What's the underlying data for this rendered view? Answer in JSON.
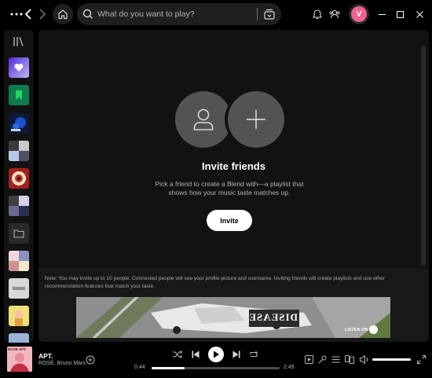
{
  "search": {
    "placeholder": "What do you want to play?"
  },
  "profile": {
    "initial": "V",
    "color": "#f06292"
  },
  "blend": {
    "title": "Invite friends",
    "description": "Pick a friend to create a Blend with—a playlist that shows how your music taste matches up.",
    "invite_button": "Invite",
    "note": "Note: You may invite up to 10 people. Connected people will see your profile picture and username. Inviting friends will create playlists and use other recommendation features that match your taste."
  },
  "ad": {
    "text": "LISTEN ON",
    "brand": "DISEASE"
  },
  "now_playing": {
    "title": "APT.",
    "artist": "ROSÉ, Bruno Mars",
    "cover_text": "ROSÉ APT.",
    "time_current": "0:44",
    "time_total": "2:49",
    "progress": 0.26,
    "volume": 1.0
  },
  "sidebar": {
    "items": [
      {
        "name": "liked-songs",
        "icon": "heart-icon",
        "color": "#7b5cf5"
      },
      {
        "name": "your-episodes",
        "icon": "bookmark-icon",
        "color": "#0f7a4d"
      },
      {
        "name": "playlist-blue",
        "icon": "playlist-cover",
        "color": "#1e3a8a"
      },
      {
        "name": "playlist-grid-1",
        "icon": "playlist-cover",
        "color": "#d0d0d0"
      },
      {
        "name": "playlist-red",
        "icon": "playlist-cover",
        "color": "#a32020"
      },
      {
        "name": "playlist-grid-2",
        "icon": "playlist-cover",
        "color": "#c8c8d8"
      },
      {
        "name": "folder",
        "icon": "folder-icon",
        "color": "#2a2a2a"
      },
      {
        "name": "playlist-photo",
        "icon": "playlist-cover",
        "color": "#e0c0c8"
      },
      {
        "name": "playlist-light",
        "icon": "playlist-cover",
        "color": "#d8d8d8"
      },
      {
        "name": "playlist-yellow",
        "icon": "playlist-cover",
        "color": "#f0e07a"
      },
      {
        "name": "playlist-bottom",
        "icon": "playlist-cover",
        "color": "#9ab4d8"
      }
    ]
  },
  "colors": {
    "accent": "#1db954",
    "panel": "#121212",
    "background": "#000000"
  }
}
